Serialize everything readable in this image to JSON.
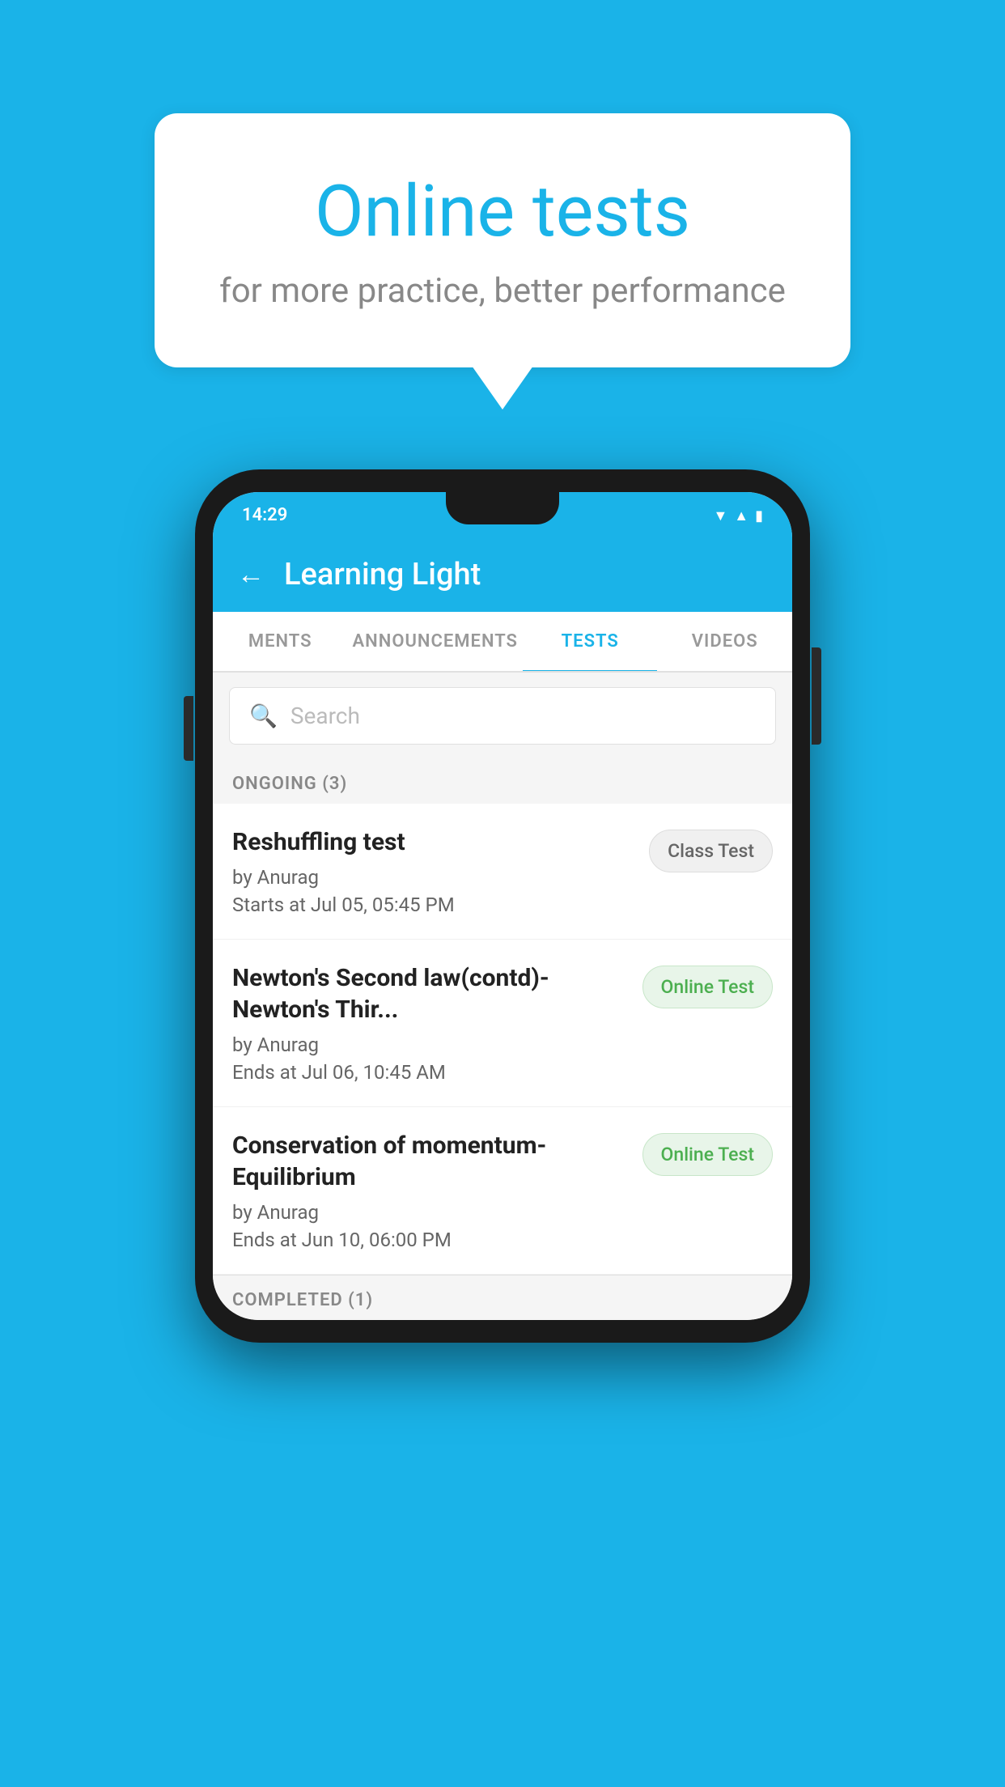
{
  "background": {
    "color": "#1ab3e8"
  },
  "speech_bubble": {
    "title": "Online tests",
    "subtitle": "for more practice, better performance"
  },
  "phone": {
    "status_bar": {
      "time": "14:29",
      "icons": [
        "wifi",
        "signal",
        "battery"
      ]
    },
    "header": {
      "back_label": "←",
      "title": "Learning Light"
    },
    "tabs": [
      {
        "label": "MENTS",
        "active": false
      },
      {
        "label": "ANNOUNCEMENTS",
        "active": false
      },
      {
        "label": "TESTS",
        "active": true
      },
      {
        "label": "VIDEOS",
        "active": false
      }
    ],
    "search": {
      "placeholder": "Search"
    },
    "ongoing_section": {
      "title": "ONGOING (3)"
    },
    "tests": [
      {
        "name": "Reshuffling test",
        "author": "by Anurag",
        "date": "Starts at  Jul 05, 05:45 PM",
        "badge": "Class Test",
        "badge_type": "class"
      },
      {
        "name": "Newton's Second law(contd)-Newton's Thir...",
        "author": "by Anurag",
        "date": "Ends at  Jul 06, 10:45 AM",
        "badge": "Online Test",
        "badge_type": "online"
      },
      {
        "name": "Conservation of momentum-Equilibrium",
        "author": "by Anurag",
        "date": "Ends at  Jun 10, 06:00 PM",
        "badge": "Online Test",
        "badge_type": "online"
      }
    ],
    "completed_section": {
      "title": "COMPLETED (1)"
    }
  }
}
